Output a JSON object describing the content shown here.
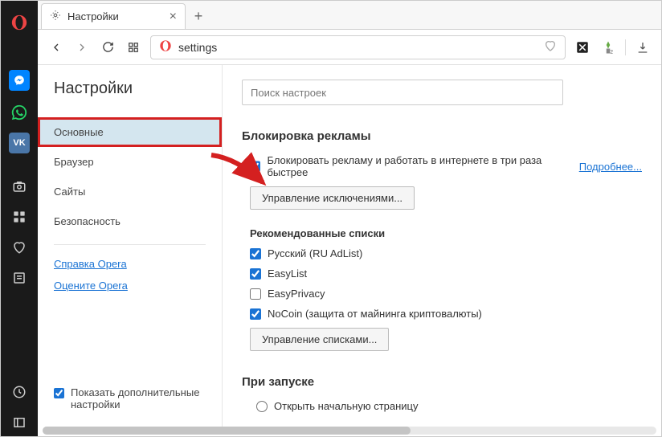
{
  "window": {
    "tab_title": "Настройки",
    "address": "settings",
    "search_placeholder": "Поиск настроек"
  },
  "sidebar": {
    "title": "Настройки",
    "items": [
      "Основные",
      "Браузер",
      "Сайты",
      "Безопасность"
    ],
    "links": [
      "Справка Opera",
      "Оцените Opera"
    ],
    "advanced_label": "Показать дополнительные настройки"
  },
  "main": {
    "adblock": {
      "title": "Блокировка рекламы",
      "main_check": "Блокировать рекламу и работать в интернете в три раза быстрее",
      "learn_more": "Подробнее...",
      "manage_exceptions": "Управление исключениями...",
      "rec_lists_title": "Рекомендованные списки",
      "lists": [
        {
          "label": "Русский (RU AdList)",
          "checked": true
        },
        {
          "label": "EasyList",
          "checked": true
        },
        {
          "label": "EasyPrivacy",
          "checked": false
        },
        {
          "label": "NoCoin (защита от майнинга криптовалюты)",
          "checked": true
        }
      ],
      "manage_lists": "Управление списками..."
    },
    "startup": {
      "title": "При запуске",
      "open_start": "Открыть начальную страницу"
    }
  }
}
